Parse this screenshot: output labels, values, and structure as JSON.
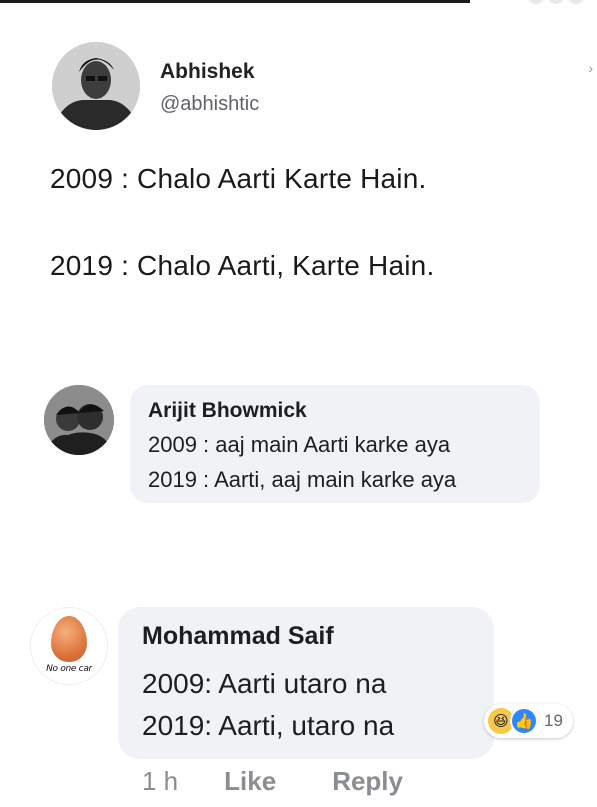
{
  "tweet": {
    "author_name": "Abhishek",
    "author_handle": "@abhishtic",
    "lines": [
      "2009 : Chalo Aarti Karte Hain.",
      "2019 : Chalo Aarti, Karte Hain."
    ]
  },
  "comments": [
    {
      "author": "Arijit Bhowmick",
      "lines": [
        "2009 : aaj main Aarti karke aya",
        "2019 : Aarti, aaj main karke aya"
      ]
    },
    {
      "author": "Mohammad Saif",
      "avatar_caption": "No one car",
      "lines": [
        "2009: Aarti utaro na",
        "2019: Aarti, utaro na"
      ],
      "reactions": {
        "types": [
          "haha-icon",
          "like-icon"
        ],
        "count": "19"
      },
      "actions": {
        "time": "1 h",
        "like": "Like",
        "reply": "Reply"
      }
    }
  ]
}
